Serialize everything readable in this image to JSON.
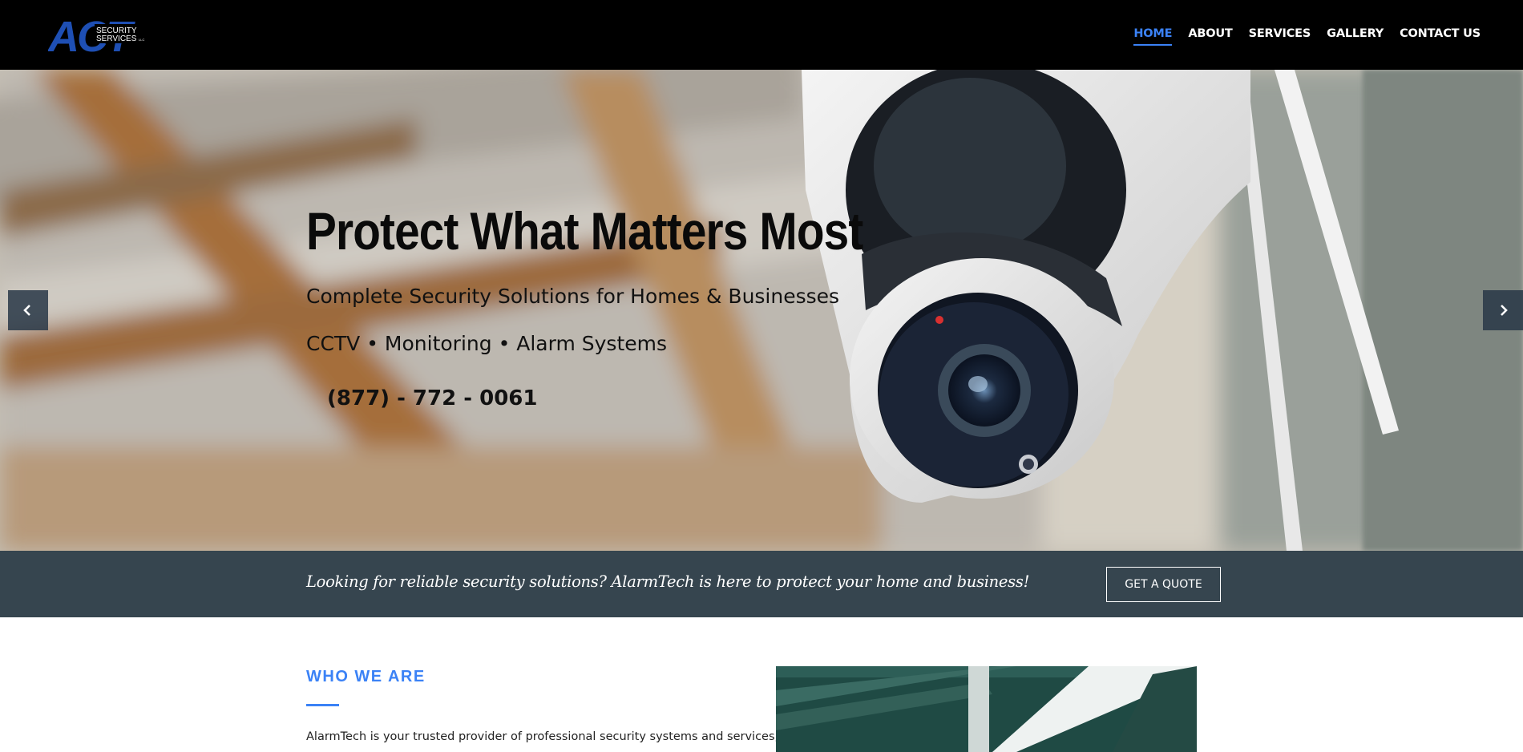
{
  "brand": {
    "logo_main": "ACT",
    "logo_line1": "SECURITY",
    "logo_line2": "SERVICES",
    "logo_suffix": "LLC",
    "accent": "#3b82f6"
  },
  "nav": {
    "items": [
      {
        "label": "HOME",
        "active": true
      },
      {
        "label": "ABOUT",
        "active": false
      },
      {
        "label": "SERVICES",
        "active": false
      },
      {
        "label": "GALLERY",
        "active": false
      },
      {
        "label": "CONTACT US",
        "active": false
      }
    ]
  },
  "hero": {
    "title": "Protect What Matters Most",
    "subtitle": "Complete Security Solutions for Homes & Businesses",
    "tags": "CCTV • Monitoring • Alarm Systems",
    "phone": "(877) - 772 - 0061",
    "prev_icon": "chevron-left-icon",
    "next_icon": "chevron-right-icon"
  },
  "cta": {
    "text": "Looking for reliable security solutions? AlarmTech is here to protect your home and business!",
    "button": "GET A QUOTE",
    "background": "#36454f"
  },
  "about": {
    "heading": "WHO WE ARE",
    "body": "AlarmTech is your trusted provider of professional security systems and services,"
  }
}
